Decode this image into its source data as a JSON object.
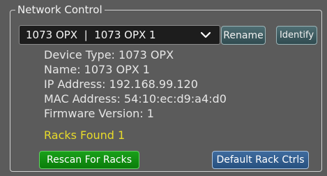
{
  "panel": {
    "title": "Network Control"
  },
  "device_select": {
    "value": "1073 OPX  |  1073 OPX 1"
  },
  "buttons": {
    "rename": "Rename",
    "identify": "Identify",
    "rescan": "Rescan For Racks",
    "default_rack_ctrls": "Default Rack Ctrls"
  },
  "device_info": {
    "type": "Device Type: 1073 OPX",
    "name": "Name: 1073 OPX 1",
    "ip": "IP Address: 192.168.99.120",
    "mac": "MAC Address: 54:10:ec:d9:a4:d0",
    "firmware": "Firmware Version: 1"
  },
  "racks_status": "Racks Found 1",
  "colors": {
    "background": "#5b5b5b",
    "racks_text": "#e8db2a",
    "rescan_button": "#0a7d0a",
    "default_button": "#26507f",
    "action_button": "#304b50"
  },
  "icons": {
    "dropdown": "chevron-down-icon"
  }
}
